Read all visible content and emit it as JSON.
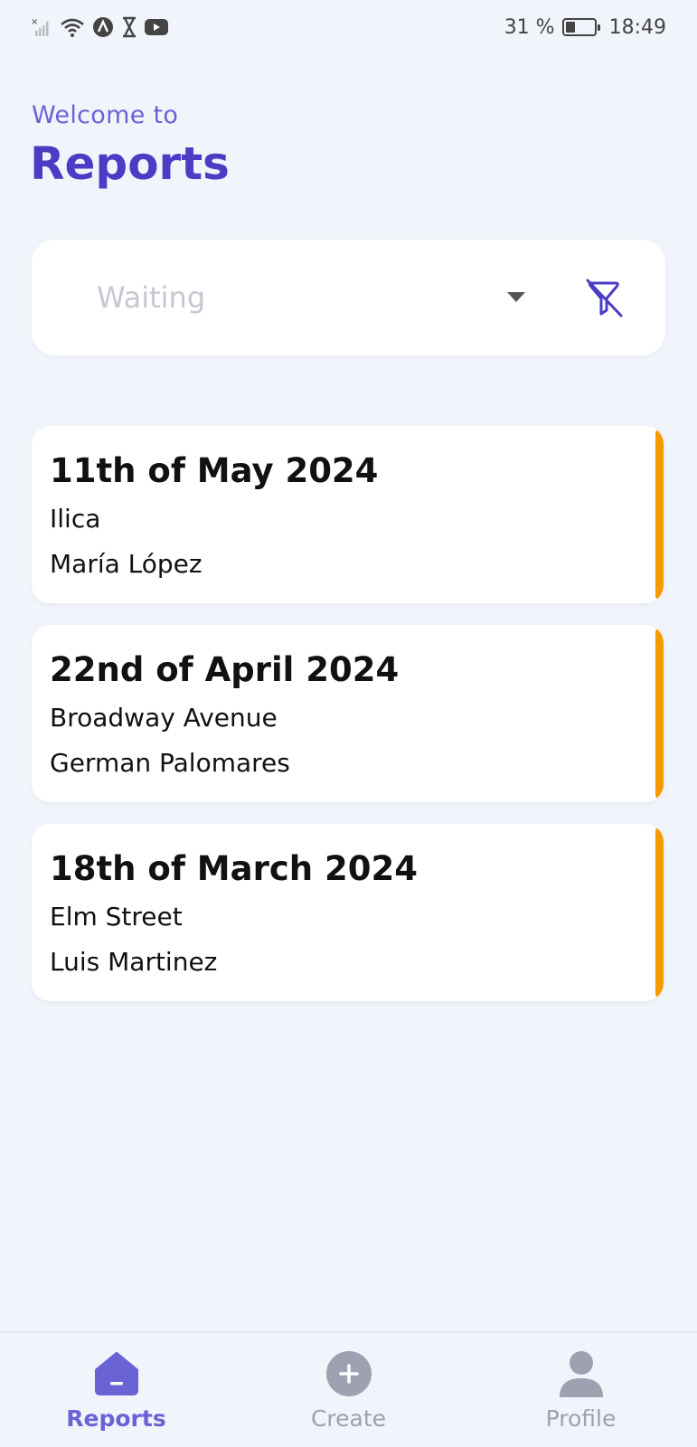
{
  "status_bar": {
    "battery_percent": "31 %",
    "time": "18:49",
    "icons": [
      "no-signal-icon",
      "wifi-icon",
      "nav-arrow-icon",
      "hourglass-icon",
      "youtube-icon",
      "battery-icon"
    ]
  },
  "header": {
    "welcome": "Welcome to",
    "title": "Reports"
  },
  "filter": {
    "selected": "Waiting",
    "clear_icon": "filter-off-icon"
  },
  "reports": [
    {
      "date": "11th of May 2024",
      "location": "Ilica",
      "person": "María López",
      "status_color": "#f59a00"
    },
    {
      "date": "22nd of April 2024",
      "location": "Broadway Avenue",
      "person": "German Palomares",
      "status_color": "#f59a00"
    },
    {
      "date": "18th of March 2024",
      "location": "Elm Street",
      "person": "Luis Martinez",
      "status_color": "#f59a00"
    }
  ],
  "bottom_nav": {
    "items": [
      {
        "label": "Reports",
        "icon": "home-icon",
        "active": true
      },
      {
        "label": "Create",
        "icon": "plus-circle-icon",
        "active": false
      },
      {
        "label": "Profile",
        "icon": "person-icon",
        "active": false
      }
    ]
  },
  "colors": {
    "accent": "#4a3cc4",
    "accent_light": "#6a63d6",
    "status_waiting": "#f59a00",
    "background": "#f1f4fa"
  }
}
